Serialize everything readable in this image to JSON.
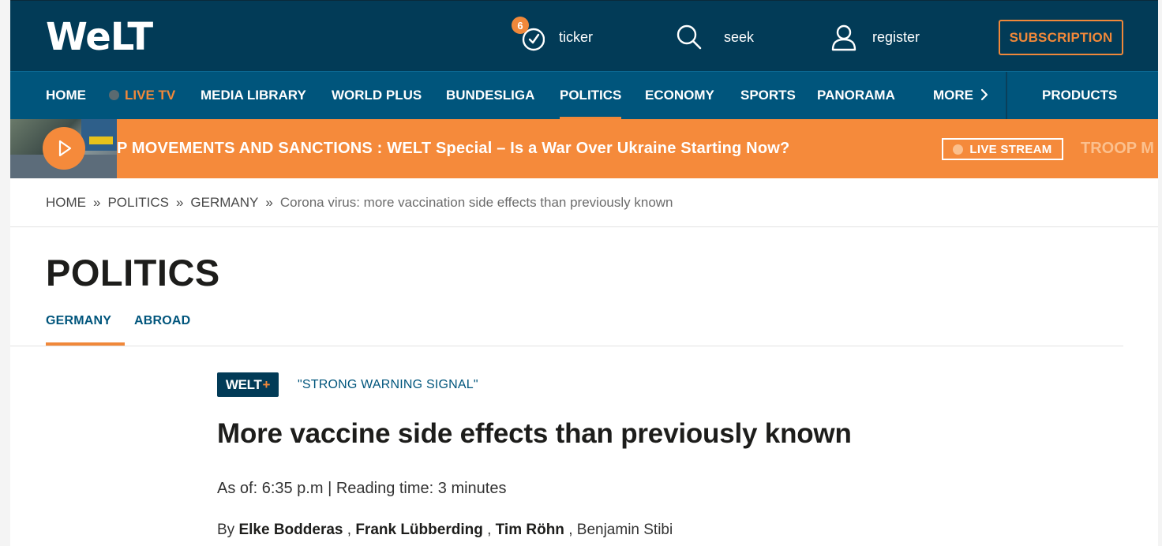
{
  "header": {
    "logo": "WeLT",
    "ticker": {
      "label": "ticker",
      "badge": "6"
    },
    "search": {
      "label": "seek"
    },
    "register": {
      "label": "register"
    },
    "subscription": "SUBSCRIPTION"
  },
  "nav": {
    "items": [
      "HOME",
      "LIVE TV",
      "MEDIA LIBRARY",
      "WORLD PLUS",
      "BUNDESLIGA",
      "POLITICS",
      "ECONOMY",
      "SPORTS",
      "PANORAMA",
      "MORE"
    ],
    "products": "PRODUCTS",
    "active": "POLITICS"
  },
  "banner": {
    "text": "P MOVEMENTS AND SANCTIONS : WELT Special – Is a War Over Ukraine Starting Now?",
    "live_stream": "LIVE STREAM",
    "trailing": "TROOP M"
  },
  "breadcrumb": {
    "items": [
      "HOME",
      "POLITICS",
      "GERMANY"
    ],
    "separator": "»",
    "current": "Corona virus: more vaccination side effects than previously known"
  },
  "section": {
    "title": "POLITICS",
    "tabs": [
      "GERMANY",
      "ABROAD"
    ],
    "active_tab": "GERMANY"
  },
  "article": {
    "badge": "WELT",
    "badge_plus": "+",
    "kicker": "\"STRONG WARNING SIGNAL\"",
    "headline": "More vaccine side effects than previously known",
    "meta": "As of: 6:35 p.m | Reading time: 3 minutes",
    "by": "By",
    "authors": [
      "Elke Bodderas",
      "Frank Lübberding",
      "Tim Röhn"
    ],
    "last_author": "Benjamin Stibi"
  },
  "colors": {
    "header_bg": "#023b57",
    "nav_bg": "#00557c",
    "accent": "#f0883a",
    "banner_bg": "#f58a3b"
  }
}
